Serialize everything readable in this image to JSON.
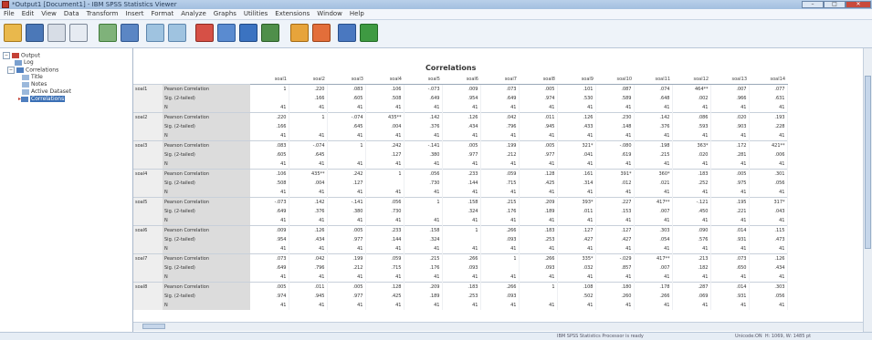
{
  "window": {
    "title": "*Output1 [Document1] - IBM SPSS Statistics Viewer"
  },
  "menu": [
    "File",
    "Edit",
    "View",
    "Data",
    "Transform",
    "Insert",
    "Format",
    "Analyze",
    "Graphs",
    "Utilities",
    "Extensions",
    "Window",
    "Help"
  ],
  "toolbar_icons": [
    "open-icon",
    "save-icon",
    "print-icon",
    "print-preview-icon",
    "export-icon",
    "recall-dialog-icon",
    "undo-icon",
    "redo-icon",
    "goto-data-icon",
    "goto-case-icon",
    "variables-icon",
    "insert-table-icon",
    "select-last-output-icon",
    "designate-window-icon",
    "show-all-icon",
    "promote-icon"
  ],
  "tree": {
    "items": [
      "Output",
      "Log",
      "Correlations",
      "Title",
      "Notes",
      "Active Dataset",
      "Correlations"
    ]
  },
  "table": {
    "title": "Correlations",
    "columns": [
      "soal1",
      "soal2",
      "soal3",
      "soal4",
      "soal5",
      "soal6",
      "soal7",
      "soal8",
      "soal9",
      "soal10",
      "soal11",
      "soal12",
      "soal13",
      "soal14"
    ],
    "stat_labels": [
      "Pearson Correlation",
      "Sig. (2-tailed)",
      "N"
    ],
    "rows": [
      {
        "var": "soal1",
        "pearson": [
          "1",
          ".220",
          ".083",
          ".106",
          "-.073",
          ".009",
          ".073",
          ".005",
          ".101",
          ".087",
          ".074",
          "464**",
          ".007",
          ".077"
        ],
        "sig": [
          "",
          ".166",
          ".605",
          ".508",
          ".649",
          ".954",
          ".649",
          ".974",
          ".530",
          ".589",
          ".648",
          ".002",
          ".966",
          ".631"
        ],
        "n": [
          "41",
          "41",
          "41",
          "41",
          "41",
          "41",
          "41",
          "41",
          "41",
          "41",
          "41",
          "41",
          "41",
          "41"
        ]
      },
      {
        "var": "soal2",
        "pearson": [
          ".220",
          "1",
          "-.074",
          "435**",
          ".142",
          ".126",
          ".042",
          ".011",
          ".126",
          ".230",
          ".142",
          ".086",
          ".020",
          ".193"
        ],
        "sig": [
          ".166",
          "",
          ".645",
          ".004",
          ".376",
          ".434",
          ".796",
          ".945",
          ".433",
          ".148",
          ".376",
          ".593",
          ".903",
          ".228"
        ],
        "n": [
          "41",
          "41",
          "41",
          "41",
          "41",
          "41",
          "41",
          "41",
          "41",
          "41",
          "41",
          "41",
          "41",
          "41"
        ]
      },
      {
        "var": "soal3",
        "pearson": [
          ".083",
          "-.074",
          "1",
          ".242",
          "-.141",
          ".005",
          ".199",
          ".005",
          "321*",
          "-.080",
          ".198",
          "363*",
          ".172",
          "421**"
        ],
        "sig": [
          ".605",
          ".645",
          "",
          ".127",
          ".380",
          ".977",
          ".212",
          ".977",
          ".041",
          ".619",
          ".215",
          ".020",
          ".281",
          ".006"
        ],
        "n": [
          "41",
          "41",
          "41",
          "41",
          "41",
          "41",
          "41",
          "41",
          "41",
          "41",
          "41",
          "41",
          "41",
          "41"
        ]
      },
      {
        "var": "soal4",
        "pearson": [
          ".106",
          "435**",
          ".242",
          "1",
          ".056",
          ".233",
          ".059",
          ".128",
          ".161",
          "391*",
          "360*",
          ".183",
          ".005",
          ".301"
        ],
        "sig": [
          ".508",
          ".004",
          ".127",
          "",
          ".730",
          ".144",
          ".715",
          ".425",
          ".314",
          ".012",
          ".021",
          ".252",
          ".975",
          ".056"
        ],
        "n": [
          "41",
          "41",
          "41",
          "41",
          "41",
          "41",
          "41",
          "41",
          "41",
          "41",
          "41",
          "41",
          "41",
          "41"
        ]
      },
      {
        "var": "soal5",
        "pearson": [
          "-.073",
          ".142",
          "-.141",
          ".056",
          "1",
          ".158",
          ".215",
          ".209",
          "393*",
          ".227",
          "417**",
          "-.121",
          ".195",
          "317*"
        ],
        "sig": [
          ".649",
          ".376",
          ".380",
          ".730",
          "",
          ".324",
          ".176",
          ".189",
          ".011",
          ".153",
          ".007",
          ".450",
          ".221",
          ".043"
        ],
        "n": [
          "41",
          "41",
          "41",
          "41",
          "41",
          "41",
          "41",
          "41",
          "41",
          "41",
          "41",
          "41",
          "41",
          "41"
        ]
      },
      {
        "var": "soal6",
        "pearson": [
          ".009",
          ".126",
          ".005",
          ".233",
          ".158",
          "1",
          ".266",
          ".183",
          ".127",
          ".127",
          ".303",
          ".090",
          ".014",
          ".115"
        ],
        "sig": [
          ".954",
          ".434",
          ".977",
          ".144",
          ".324",
          "",
          ".093",
          ".253",
          ".427",
          ".427",
          ".054",
          ".576",
          ".931",
          ".473"
        ],
        "n": [
          "41",
          "41",
          "41",
          "41",
          "41",
          "41",
          "41",
          "41",
          "41",
          "41",
          "41",
          "41",
          "41",
          "41"
        ]
      },
      {
        "var": "soal7",
        "pearson": [
          ".073",
          ".042",
          ".199",
          ".059",
          ".215",
          ".266",
          "1",
          ".266",
          "335*",
          "-.029",
          "417**",
          ".213",
          ".073",
          ".126"
        ],
        "sig": [
          ".649",
          ".796",
          ".212",
          ".715",
          ".176",
          ".093",
          "",
          ".093",
          ".032",
          ".857",
          ".007",
          ".182",
          ".650",
          ".434"
        ],
        "n": [
          "41",
          "41",
          "41",
          "41",
          "41",
          "41",
          "41",
          "41",
          "41",
          "41",
          "41",
          "41",
          "41",
          "41"
        ]
      },
      {
        "var": "soal8",
        "pearson": [
          ".005",
          ".011",
          ".005",
          ".128",
          ".209",
          ".183",
          ".266",
          "1",
          ".108",
          ".180",
          ".178",
          ".287",
          ".014",
          ".303"
        ],
        "sig": [
          ".974",
          ".945",
          ".977",
          ".425",
          ".189",
          ".253",
          ".093",
          "",
          ".502",
          ".260",
          ".266",
          ".069",
          ".931",
          ".056"
        ],
        "n": [
          "41",
          "41",
          "41",
          "41",
          "41",
          "41",
          "41",
          "41",
          "41",
          "41",
          "41",
          "41",
          "41",
          "41"
        ]
      }
    ]
  },
  "status": {
    "processor": "IBM SPSS Statistics Processor is ready",
    "unicode": "Unicode:ON",
    "dims": "H: 1069, W: 1485 pt"
  }
}
